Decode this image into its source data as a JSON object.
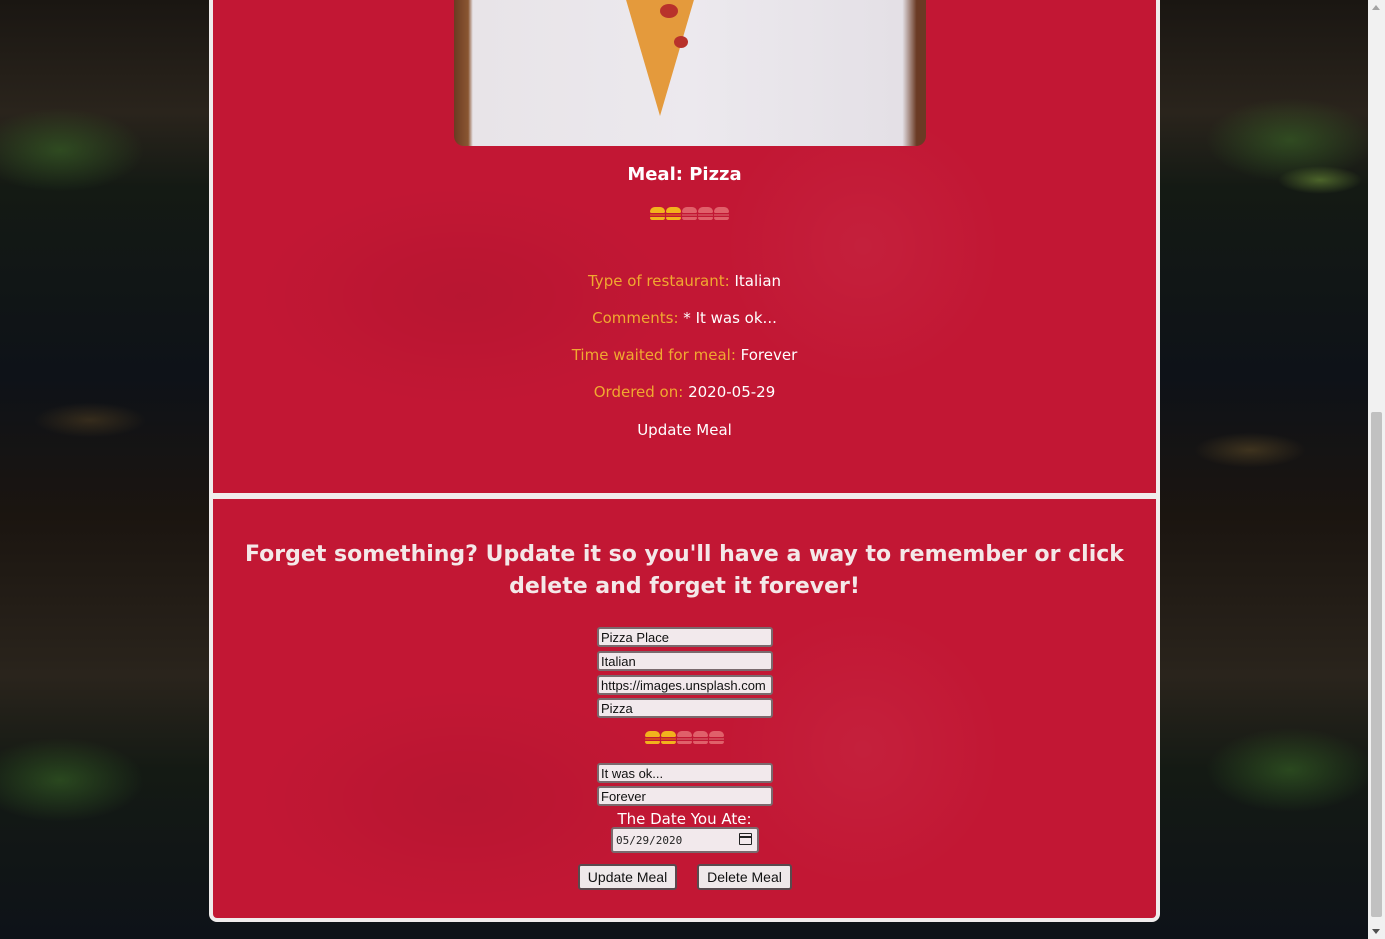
{
  "meal": {
    "title": "Meal: Pizza",
    "rating": 2,
    "rating_max": 5,
    "details": [
      {
        "label": "Type of restaurant:",
        "value": "Italian"
      },
      {
        "label": "Comments:",
        "value": "* It was ok..."
      },
      {
        "label": "Time waited for meal:",
        "value": "Forever"
      },
      {
        "label": "Ordered on:",
        "value": "2020-05-29"
      }
    ],
    "update_link": "Update Meal"
  },
  "form": {
    "heading": "Forget something? Update it so you'll have a way to remember or click delete and forget it forever!",
    "restaurant_value": "Pizza Place",
    "type_value": "Italian",
    "image_value": "https://images.unsplash.com",
    "meal_value": "Pizza",
    "rating": 2,
    "comments_value": "It was ok...",
    "wait_value": "Forever",
    "date_label": "The Date You Ate:",
    "date_value": "05/29/2020",
    "update_button": "Update Meal",
    "delete_button": "Delete Meal"
  },
  "colors": {
    "card": "#c21734",
    "label": "#f0a830",
    "rating_on": "#f2b21d",
    "rating_off": "#e0606a"
  },
  "icons": [
    "burger-rating-icon",
    "calendar-icon"
  ]
}
